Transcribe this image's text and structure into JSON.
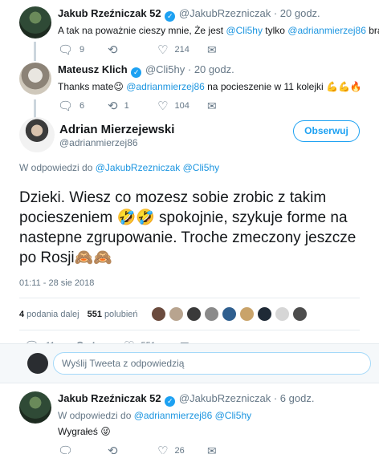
{
  "tweets_above": [
    {
      "name": "Jakub Rzeźniczak 52",
      "handle": "@JakubRzezniczak",
      "time": "· 20 godz.",
      "text_parts": [
        "A tak na poważnie cieszy mnie,  Że jest ",
        "@Cli5hy",
        " tylko ",
        "@adrianmierzej86",
        " brak"
      ],
      "emoji": "😡",
      "replies": "9",
      "retweets": "",
      "likes": "214"
    },
    {
      "name": "Mateusz Klich",
      "handle": "@Cli5hy",
      "time": "· 20 godz.",
      "text_parts": [
        "Thanks mate",
        " ",
        "@adrianmierzej86",
        " na pocieszenie w 11 kolejki "
      ],
      "emoji_mid": "😉",
      "emoji": "💪💪🔥",
      "replies": "6",
      "retweets": "1",
      "likes": "104"
    }
  ],
  "main_tweet": {
    "name": "Adrian Mierzejewski",
    "handle": "@adrianmierzej86",
    "follow_label": "Obserwuj",
    "reply_prefix": "W odpowiedzi do ",
    "reply_to_1": "@JakubRzezniczak",
    "reply_to_2": "@Cli5hy",
    "text_1": "Dzieki. Wiesz co mozesz sobie zrobic z takim pocieszeniem ",
    "emoji_1": "🤣🤣",
    "text_2": " spokojnie, szykuje forme na nastepne zgrupowanie. Troche zmeczony jeszcze po Rosji",
    "emoji_2": "🙈🙈",
    "timestamp": "01:11 - 28 sie 2018",
    "retweets_count": "4",
    "retweets_label": "podania dalej",
    "likes_count": "551",
    "likes_label": "polubień",
    "action_replies": "11",
    "action_retweets": "4",
    "action_likes": "551"
  },
  "reply_box": {
    "placeholder": "Wyślij Tweeta z odpowiedzią"
  },
  "tweet_below": {
    "name": "Jakub Rzeźniczak 52",
    "handle": "@JakubRzezniczak",
    "time": "· 6 godz.",
    "reply_prefix": "W odpowiedzi do ",
    "reply_to_1": "@adrianmierzej86",
    "reply_to_2": "@Cli5hy",
    "text": "Wygrałeś ",
    "emoji": "😜",
    "replies": "",
    "retweets": "",
    "likes": "26"
  },
  "icons": {
    "reply": "reply-icon",
    "retweet": "retweet-icon",
    "like": "heart-icon",
    "dm": "envelope-icon",
    "verified": "verified-badge-icon"
  },
  "colors": {
    "accent": "#1da1f2",
    "mention": "#1b95e0",
    "muted": "#657786"
  }
}
